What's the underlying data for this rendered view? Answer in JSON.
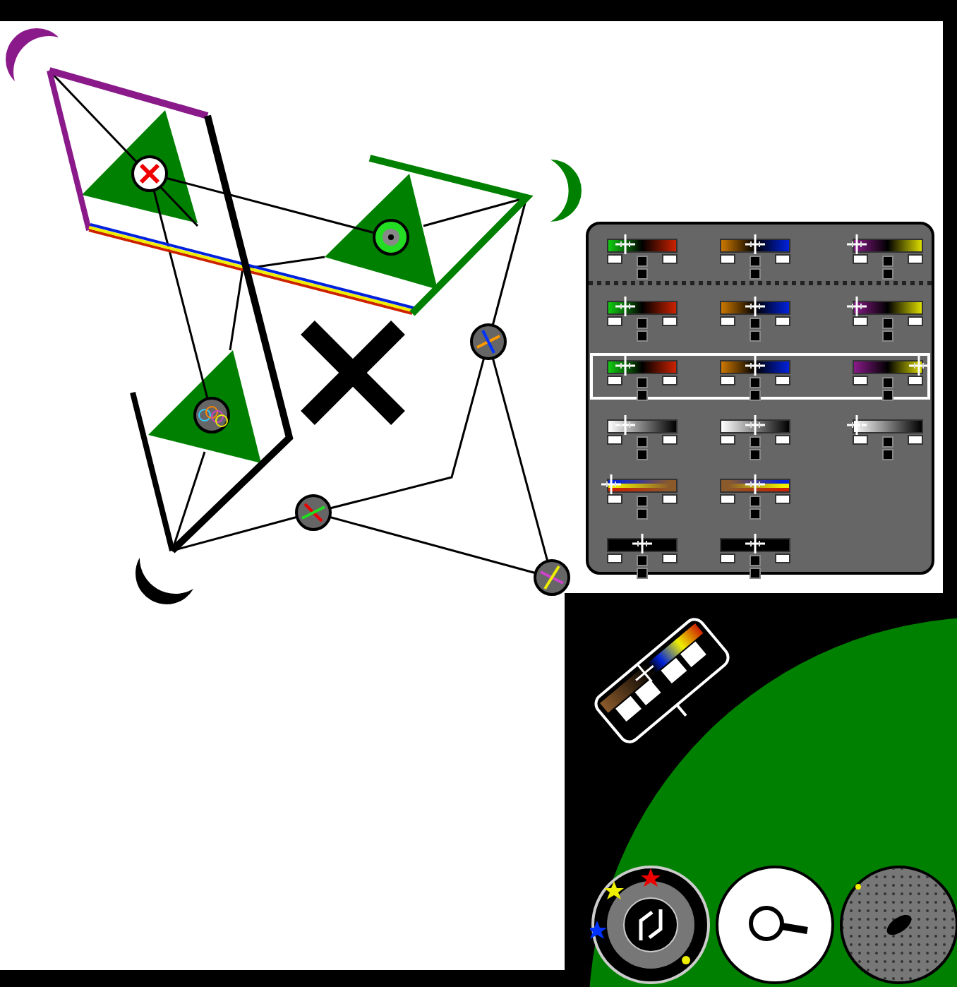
{
  "gradient_panel": {
    "recent": {
      "gradients": [
        {
          "kind": "greenred",
          "level": 0.25
        },
        {
          "kind": "orangeblue",
          "level": 0.5
        },
        {
          "kind": "purpleyellow",
          "level": 0.05
        }
      ]
    },
    "rows": [
      {
        "selected": false,
        "gradients": [
          {
            "kind": "greenred",
            "level": 0.25
          },
          {
            "kind": "orangeblue",
            "level": 0.5
          },
          {
            "kind": "purpleyellow",
            "level": 0.05
          }
        ]
      },
      {
        "selected": true,
        "gradients": [
          {
            "kind": "greenred",
            "level": 0.25
          },
          {
            "kind": "orangeblue",
            "level": 0.5
          },
          {
            "kind": "purpleyellow",
            "level": 0.95
          }
        ]
      },
      {
        "selected": false,
        "gradients": [
          {
            "kind": "whiteblack",
            "level": 0.25
          },
          {
            "kind": "whiteblack",
            "level": 0.5
          },
          {
            "kind": "whiteblack",
            "level": 0.05
          }
        ]
      },
      {
        "selected": false,
        "gradients": [
          {
            "kind": "stripesbrown",
            "level": 0.05
          },
          {
            "kind": "brownstripes",
            "level": 0.5
          }
        ]
      },
      {
        "selected": false,
        "gradients": [
          {
            "kind": "black",
            "level": 0.5
          },
          {
            "kind": "black",
            "level": 0.5
          }
        ]
      }
    ]
  },
  "tools": [
    {
      "kind": "rotate"
    },
    {
      "kind": "magnify"
    },
    {
      "kind": "scatter"
    }
  ]
}
